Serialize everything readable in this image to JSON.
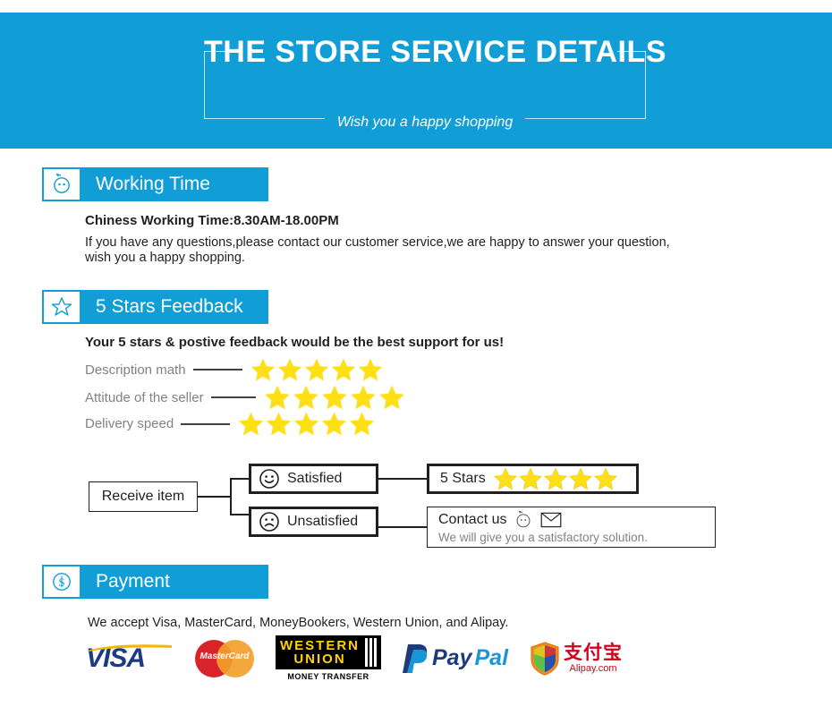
{
  "banner": {
    "title": "THE STORE SERVICE DETAILS",
    "subtitle": "Wish you a happy shopping",
    "color": "#119dd6"
  },
  "sections": {
    "working_time": {
      "label": "Working Time",
      "icon": "chat-face-icon",
      "line1": "Chiness Working Time:8.30AM-18.00PM",
      "line2": "If you have any questions,please contact our customer service,we are happy to answer your question,",
      "line3": "wish you a happy shopping."
    },
    "feedback": {
      "label": "5 Stars Feedback",
      "icon": "star-outline-icon",
      "headline": "Your 5 stars & postive feedback would be the best support for us!",
      "rows": [
        {
          "label": "Description math",
          "stars": 5
        },
        {
          "label": "Attitude of the seller",
          "stars": 5
        },
        {
          "label": "Delivery speed",
          "stars": 5
        }
      ]
    },
    "payment": {
      "label": "Payment",
      "icon": "dollar-circle-icon",
      "note": "We accept Visa, MasterCard, MoneyBookers, Western Union, and Alipay.",
      "logos": [
        {
          "name": "visa-logo",
          "text": "VISA"
        },
        {
          "name": "mastercard-logo",
          "text": "MasterCard"
        },
        {
          "name": "western-union-logo",
          "line1": "WESTERN",
          "line2": "UNION",
          "sub": "MONEY TRANSFER"
        },
        {
          "name": "paypal-logo",
          "text1": "Pay",
          "text2": "Pal"
        },
        {
          "name": "alipay-logo",
          "cn": "支付宝",
          "en": "Alipay.com"
        }
      ]
    }
  },
  "flowchart": {
    "start": "Receive item",
    "satisfied": {
      "label": "Satisfied",
      "icon": "smiley-face-icon"
    },
    "unsatisfied": {
      "label": "Unsatisfied",
      "icon": "sad-face-icon"
    },
    "result_satisfied": {
      "label": "5 Stars",
      "stars": 5
    },
    "result_unsatisfied": {
      "label": "Contact us",
      "sub": "We will give you a satisfactory solution.",
      "icons": [
        "chat-face-icon",
        "envelope-icon"
      ]
    }
  },
  "colors": {
    "brand_blue": "#119dd6",
    "star_yellow": "#ffe017",
    "gray_text": "#808285"
  }
}
